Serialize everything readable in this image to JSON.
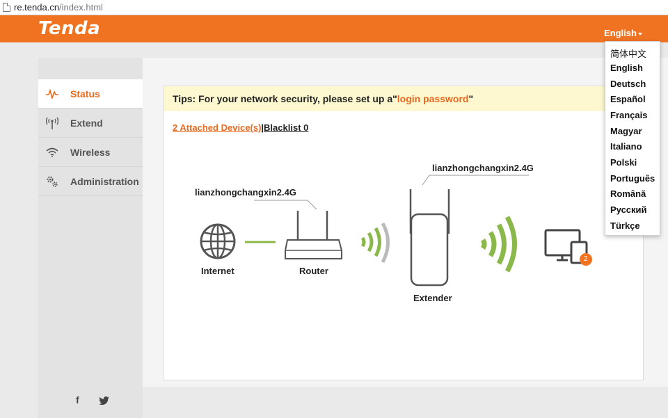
{
  "browser": {
    "url_host": "re.tenda.cn",
    "url_path": "/index.html"
  },
  "header": {
    "logo": "Tenda",
    "language": "English"
  },
  "sidebar": {
    "items": [
      {
        "label": "Status",
        "icon": "pulse-icon",
        "active": true
      },
      {
        "label": "Extend",
        "icon": "antenna-icon",
        "active": false
      },
      {
        "label": "Wireless",
        "icon": "wifi-icon",
        "active": false
      },
      {
        "label": "Administration",
        "icon": "gears-icon",
        "active": false
      }
    ],
    "social": {
      "facebook": "f",
      "twitter": "twitter-icon"
    }
  },
  "main": {
    "tip": {
      "prefix": "Tips: For your network security, please set up a\"",
      "link": "login password",
      "suffix": "\""
    },
    "attached": "2 Attached Device(s)",
    "separator": "|",
    "blacklist": "Blacklist 0",
    "diagram": {
      "internet_label": "Internet",
      "router_label": "Router",
      "router_ssid": "lianzhongchangxin2.4G",
      "extender_label": "Extender",
      "extender_ssid": "lianzhongchangxin2.4G",
      "device_count": "2"
    }
  },
  "language_menu": {
    "options": [
      "简体中文",
      "English",
      "Deutsch",
      "Español",
      "Français",
      "Magyar",
      "Italiano",
      "Polski",
      "Português",
      "Română",
      "Русский",
      "Türkçe"
    ]
  },
  "colors": {
    "accent": "#f07322",
    "link": "#e8691f",
    "signal_green": "#8ab84a",
    "tip_bg": "#fdf8cf"
  }
}
